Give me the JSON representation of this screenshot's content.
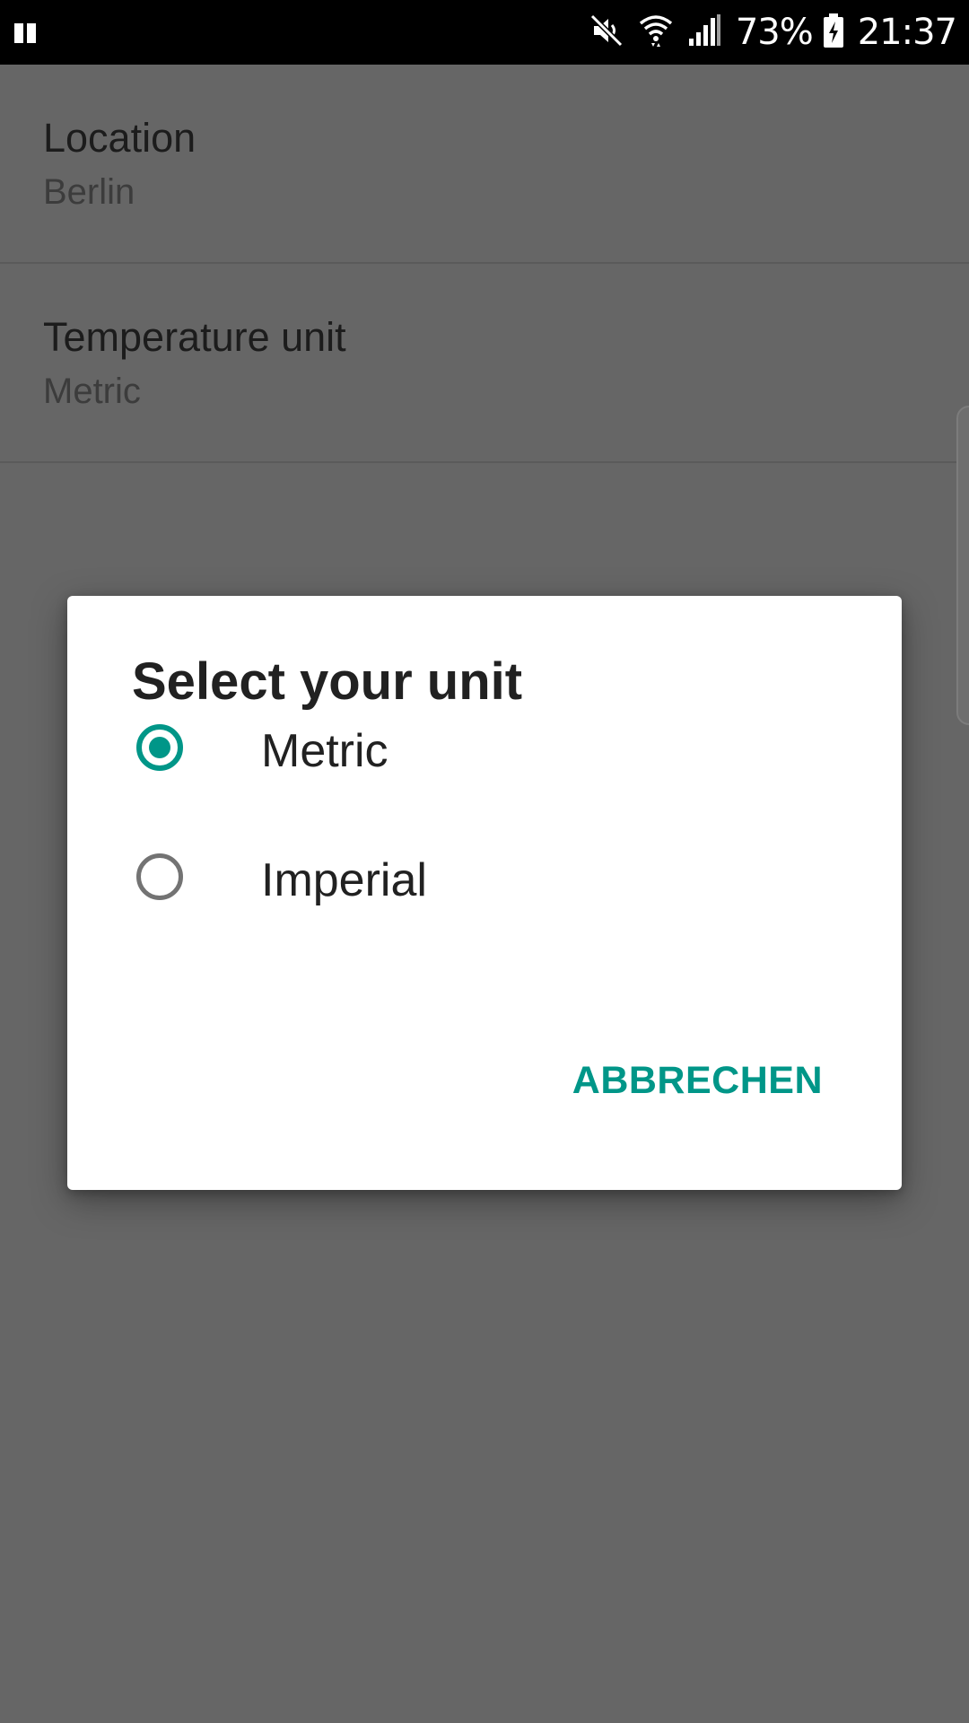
{
  "status_bar": {
    "battery_percent": "73%",
    "time": "21:37",
    "icons": [
      "notification-paused-icon",
      "mute-icon",
      "wifi-icon",
      "cell-signal-icon",
      "battery-charging-icon"
    ]
  },
  "settings": {
    "items": [
      {
        "title": "Location",
        "summary": "Berlin"
      },
      {
        "title": "Temperature unit",
        "summary": "Metric"
      }
    ]
  },
  "dialog": {
    "title": "Select your unit",
    "options": [
      {
        "label": "Metric",
        "selected": true
      },
      {
        "label": "Imperial",
        "selected": false
      }
    ],
    "cancel_label": "ABBRECHEN"
  },
  "colors": {
    "accent": "#009688",
    "scrim_background": "#666666",
    "status_bar": "#000000",
    "dialog_background": "#ffffff"
  }
}
